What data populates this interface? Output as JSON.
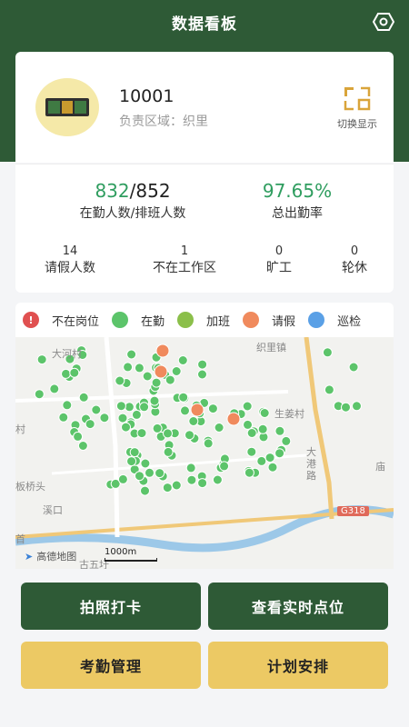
{
  "header": {
    "title": "数据看板",
    "settings_icon": "settings-hex-icon"
  },
  "card": {
    "id": "10001",
    "area_label": "负责区域：",
    "area_value": "织里",
    "switch_label": "切换显示",
    "switch_icon": "switch-display-icon",
    "avatar_icon": "avatar-badge-icon"
  },
  "stats": {
    "on_duty": "832",
    "scheduled": "852",
    "on_duty_label": "在勤人数/排班人数",
    "rate": "97.65%",
    "rate_label": "总出勤率",
    "leave": {
      "num": "14",
      "label": "请假人数"
    },
    "out_of_zone": {
      "num": "1",
      "label": "不在工作区"
    },
    "absent": {
      "num": "0",
      "label": "旷工"
    },
    "rest": {
      "num": "0",
      "label": "轮休"
    }
  },
  "legend": [
    {
      "label": "不在岗位",
      "color": "#e05050",
      "icon": "alert-icon"
    },
    {
      "label": "在勤",
      "color": "#5cc46a",
      "icon": "leaf-icon"
    },
    {
      "label": "加班",
      "color": "#8bbf4a",
      "icon": "swirl-icon"
    },
    {
      "label": "请假",
      "color": "#f08a5d",
      "icon": "leave-icon"
    },
    {
      "label": "巡检",
      "color": "#5aa0e6",
      "icon": "patrol-icon"
    }
  ],
  "map": {
    "places": [
      "大河村",
      "织里镇",
      "生姜村",
      "村",
      "板桥头",
      "溪口",
      "首",
      "古五圩",
      "庙",
      "大港路"
    ],
    "road_badge": "G318",
    "brand": "高德地图",
    "scale": "1000m"
  },
  "buttons": {
    "checkin": "拍照打卡",
    "realtime": "查看实时点位",
    "attendance": "考勤管理",
    "schedule": "计划安排"
  }
}
